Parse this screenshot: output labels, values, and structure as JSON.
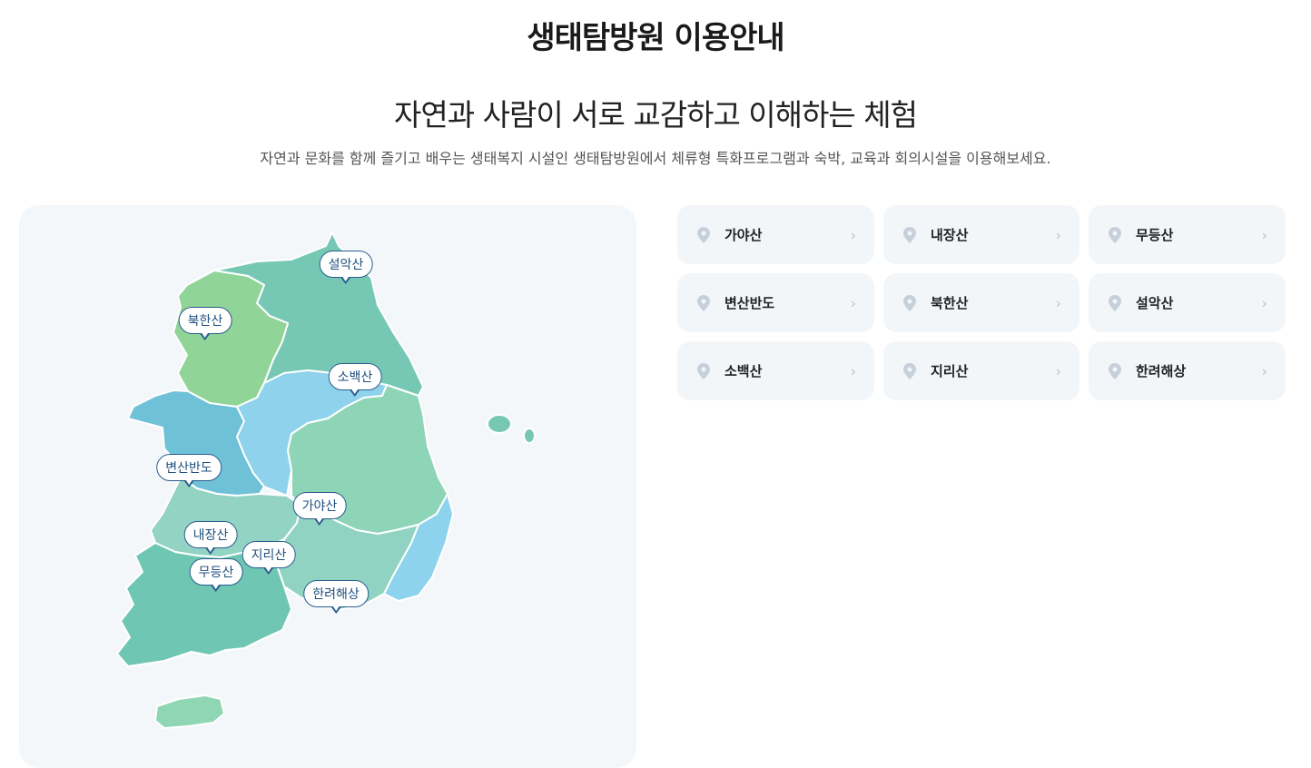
{
  "header": {
    "title": "생태탐방원 이용안내",
    "subtitle": "자연과 사람이 서로 교감하고 이해하는 체험",
    "description": "자연과 문화를 함께 즐기고 배우는 생태복지 시설인 생태탐방원에서 체류형 특화프로그램과 숙박, 교육과 회의시설을 이용해보세요."
  },
  "map": {
    "markers": [
      "설악산",
      "북한산",
      "소백산",
      "변산반도",
      "가야산",
      "내장산",
      "지리산",
      "무등산",
      "한려해상"
    ]
  },
  "sites": [
    {
      "name": "가야산"
    },
    {
      "name": "내장산"
    },
    {
      "name": "무등산"
    },
    {
      "name": "변산반도"
    },
    {
      "name": "북한산"
    },
    {
      "name": "설악산"
    },
    {
      "name": "소백산"
    },
    {
      "name": "지리산"
    },
    {
      "name": "한려해상"
    }
  ],
  "icons": {
    "site_marker": "map-pin-icon",
    "site_arrow": "chevron-right-icon"
  },
  "colors": {
    "gangwon": "#76c8b4",
    "gyeonggi": "#90d498",
    "chungnam": "#6fc1d8",
    "chungbuk": "#8fd2ec",
    "gyeongbuk": "#8ed5b7",
    "jeonbuk": "#93d3c4",
    "jeonnam": "#6fc6b2",
    "gyeongnam": "#90d3c2",
    "busan": "#8dd3ed",
    "jeju": "#8fd6b4",
    "marker_border": "#2b5d8f",
    "card_bg": "#f3f6f9"
  }
}
